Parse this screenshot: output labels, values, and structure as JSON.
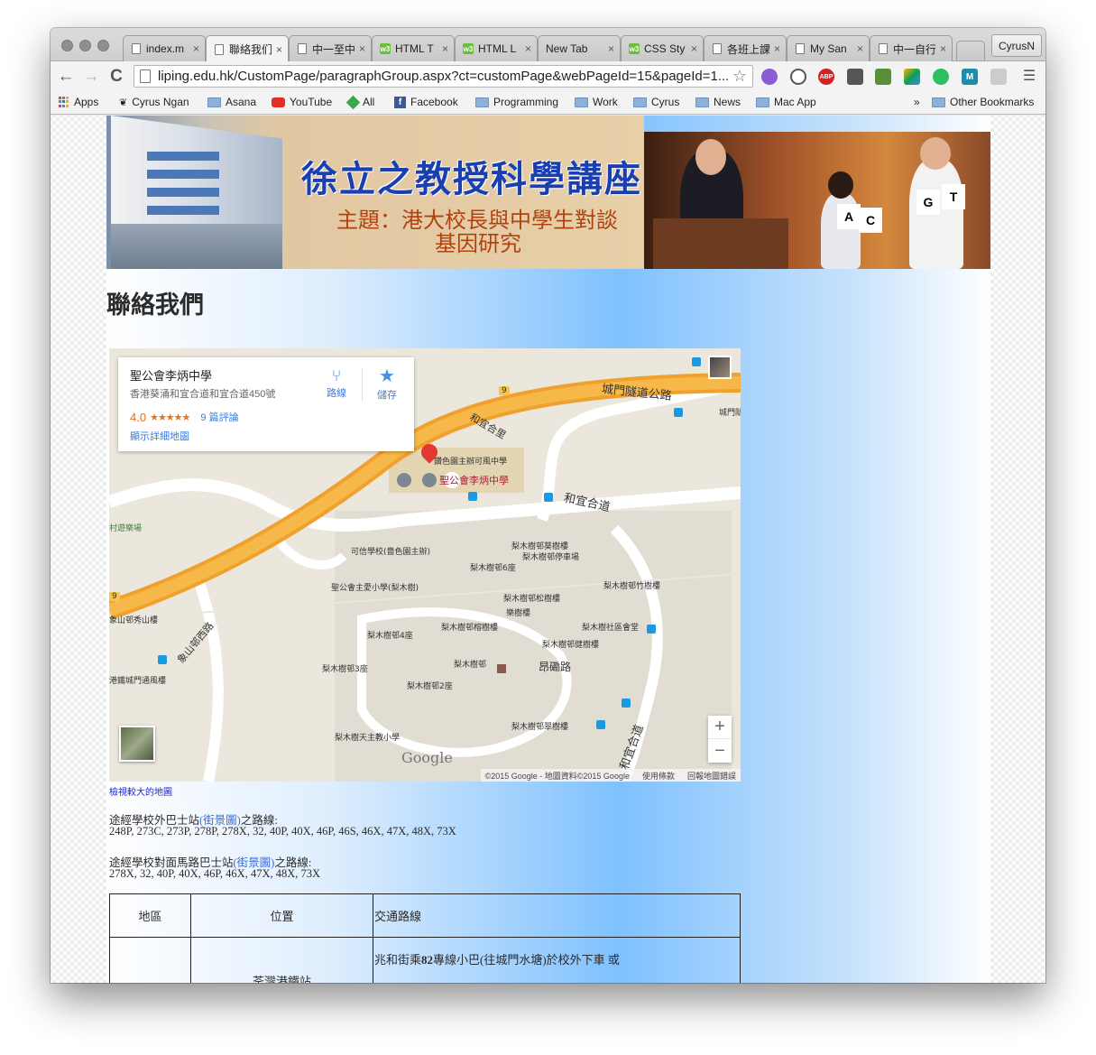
{
  "browser": {
    "tabs": [
      {
        "label": "index.m",
        "icon": "page"
      },
      {
        "label": "聯絡我们",
        "icon": "page",
        "active": true
      },
      {
        "label": "中一至中",
        "icon": "page"
      },
      {
        "label": "HTML T",
        "icon": "w3"
      },
      {
        "label": "HTML L",
        "icon": "w3"
      },
      {
        "label": "New Tab",
        "icon": "none"
      },
      {
        "label": "CSS Sty",
        "icon": "w3"
      },
      {
        "label": "各班上課",
        "icon": "page"
      },
      {
        "label": "My San",
        "icon": "page"
      },
      {
        "label": "中一自行",
        "icon": "page"
      }
    ],
    "tab_close": "×",
    "profile": "CyrusN",
    "nav": {
      "back": "←",
      "forward": "→",
      "reload": "C"
    },
    "url": "liping.edu.hk/CustomPage/paragraphGroup.aspx?ct=customPage&webPageId=15&pageId=1...",
    "star": "☆",
    "extensions": {
      "abp": "ABP",
      "medium": "M"
    },
    "menu": "☰",
    "bookmarks": {
      "apps": "Apps",
      "items": [
        "Cyrus Ngan",
        "Asana",
        "YouTube",
        "All",
        "Facebook",
        "Programming",
        "Work",
        "Cyrus",
        "News",
        "Mac App"
      ],
      "overflow": "»",
      "other": "Other Bookmarks"
    }
  },
  "page": {
    "banner": {
      "title": "徐立之教授科學講座",
      "subtitle_line1": "主題：港大校長與中學生對談",
      "subtitle_line2": "基因研究",
      "cards": [
        "A",
        "C",
        "G",
        "T"
      ]
    },
    "heading": "聯絡我們",
    "map": {
      "place_name": "聖公會李炳中學",
      "address": "香港葵涌和宜合道和宜合道450號",
      "directions": "路線",
      "save": "儲存",
      "rating": "4.0",
      "stars": "★★★★★",
      "reviews": "9 篇評論",
      "view_larger": "顯示詳細地圖",
      "marker_label": "聖公會李炳中學",
      "road_labels": [
        "城門隧道公路",
        "和宜合道",
        "和宜合里",
        "象山邨西路",
        "昂磡路",
        "和宜合道"
      ],
      "place_labels": [
        "鑽色園主辦可風中學",
        "可信學校(嗇色園主辦)",
        "聖公會主愛小學(梨木樹)",
        "梨木樹邨葵樹樓",
        "梨木樹邨停車場",
        "梨木樹邨6座",
        "梨木樹邨竹樹樓",
        "梨木樹邨松樹樓",
        "樂樹樓",
        "梨木樹邨榕樹樓",
        "梨木樹社區會堂",
        "梨木樹邨4座",
        "梨木樹邨健樹樓",
        "梨木樹邨",
        "梨木樹邨3座",
        "梨木樹邨2座",
        "梨木樹邨翠樹樓",
        "梨木樹天主教小學",
        "象山邨秀山樓",
        "港鐵城門通風樓",
        "城門隧",
        "村遊樂場",
        "梨木樹邨葵樹樓"
      ],
      "route_number_badges": [
        "9",
        "9"
      ],
      "google": "Google",
      "attribution": [
        "©2015 Google - 地圖資料©2015 Google",
        "使用條款",
        "回報地圖錯誤"
      ],
      "zoom_in": "+",
      "zoom_out": "−"
    },
    "map_link": "檢視較大的地圖",
    "bus_stop_1": {
      "prefix": "途經學校外巴士站",
      "link": "(街景圖)",
      "suffix": "之路線:",
      "routes": "248P, 273C, 273P, 278P, 278X, 32, 40P, 40X, 46P, 46S, 46X, 47X, 48X, 73X"
    },
    "bus_stop_2": {
      "prefix": "途經學校對面馬路巴士站",
      "link": "(街景圖)",
      "suffix": "之路線:",
      "routes": "278X, 32, 40P, 40X, 46P, 46X, 47X, 48X, 73X"
    },
    "table": {
      "headers": [
        "地區",
        "位置",
        "交通路線"
      ],
      "row1": {
        "location": "荃灣港鐵站",
        "route_prefix": "兆和街乘",
        "route_bold": "82",
        "route_suffix": "專線小巴(往城門水塘)於校外下車 或"
      }
    }
  }
}
